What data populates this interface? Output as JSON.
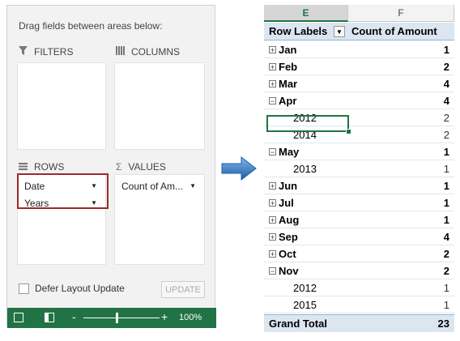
{
  "field_list": {
    "instruction": "Drag fields between areas below:",
    "areas": {
      "filters": {
        "label": "FILTERS",
        "icon": "filter-icon"
      },
      "columns": {
        "label": "COLUMNS",
        "icon": "columns-icon"
      },
      "rows": {
        "label": "ROWS",
        "icon": "rows-icon",
        "fields": [
          "Date",
          "Years"
        ]
      },
      "values": {
        "label": "VALUES",
        "icon": "sigma-icon",
        "fields": [
          "Count of Am..."
        ]
      }
    },
    "defer_label": "Defer Layout Update",
    "update_label": "UPDATE"
  },
  "status_bar": {
    "zoom": "100%",
    "minus": "-",
    "plus": "+"
  },
  "sheet": {
    "columns": [
      "E",
      "F"
    ],
    "header": {
      "row_labels": "Row Labels",
      "amount": "Count of Amount"
    },
    "rows": [
      {
        "label": "Jan",
        "value": "1",
        "level": "month",
        "expander": "+"
      },
      {
        "label": "Feb",
        "value": "2",
        "level": "month",
        "expander": "+"
      },
      {
        "label": "Mar",
        "value": "4",
        "level": "month",
        "expander": "+"
      },
      {
        "label": "Apr",
        "value": "4",
        "level": "month",
        "expander": "−"
      },
      {
        "label": "2012",
        "value": "2",
        "level": "sub"
      },
      {
        "label": "2014",
        "value": "2",
        "level": "sub"
      },
      {
        "label": "May",
        "value": "1",
        "level": "month",
        "expander": "−"
      },
      {
        "label": "2013",
        "value": "1",
        "level": "sub"
      },
      {
        "label": "Jun",
        "value": "1",
        "level": "month",
        "expander": "+"
      },
      {
        "label": "Jul",
        "value": "1",
        "level": "month",
        "expander": "+"
      },
      {
        "label": "Aug",
        "value": "1",
        "level": "month",
        "expander": "+"
      },
      {
        "label": "Sep",
        "value": "4",
        "level": "month",
        "expander": "+"
      },
      {
        "label": "Oct",
        "value": "2",
        "level": "month",
        "expander": "+"
      },
      {
        "label": "Nov",
        "value": "2",
        "level": "month",
        "expander": "−"
      },
      {
        "label": "2012",
        "value": "1",
        "level": "sub"
      },
      {
        "label": "2015",
        "value": "1",
        "level": "sub"
      }
    ],
    "grand_total": {
      "label": "Grand Total",
      "value": "23"
    }
  },
  "colors": {
    "excel_green": "#217346",
    "pivot_header": "#dce6f1",
    "highlight_border": "#9b2a2a",
    "arrow_blue": "#2e75b6"
  }
}
